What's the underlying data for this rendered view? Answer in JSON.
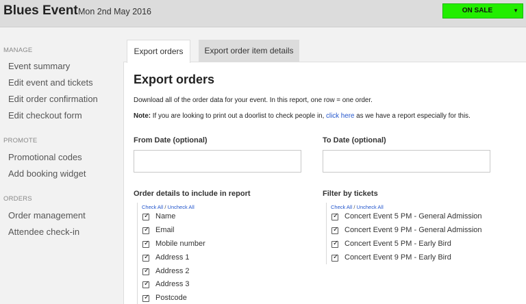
{
  "header": {
    "title": "Blues Event",
    "date": "Mon 2nd May 2016",
    "status": "ON SALE",
    "status_caret": "▼",
    "status_color": "#22ee00"
  },
  "sidebar": {
    "sections": [
      {
        "label": "MANAGE",
        "items": [
          "Event summary",
          "Edit event and tickets",
          "Edit order confirmation",
          "Edit checkout form"
        ]
      },
      {
        "label": "PROMOTE",
        "items": [
          "Promotional codes",
          "Add booking widget"
        ]
      },
      {
        "label": "ORDERS",
        "items": [
          "Order management",
          "Attendee check-in"
        ]
      }
    ]
  },
  "tabs": [
    {
      "label": "Export orders",
      "active": true
    },
    {
      "label": "Export order item details",
      "active": false
    }
  ],
  "main": {
    "heading": "Export orders",
    "intro": "Download all of the order data for your event. In this report, one row = one order.",
    "note_bold": "Note:",
    "note_pre": "If you are looking to print out a doorlist to check people in,",
    "note_link": "click here",
    "note_post": "as we have a report especially for this.",
    "from_date": {
      "label": "From Date (optional)",
      "value": "",
      "placeholder": ""
    },
    "to_date": {
      "label": "To Date (optional)",
      "value": "",
      "placeholder": ""
    },
    "order_details": {
      "label": "Order details to include in report",
      "check_all": "Check All",
      "separator": "/",
      "uncheck_all": "Uncheck All",
      "items": [
        {
          "label": "Name",
          "checked": true
        },
        {
          "label": "Email",
          "checked": true
        },
        {
          "label": "Mobile number",
          "checked": true
        },
        {
          "label": "Address 1",
          "checked": true
        },
        {
          "label": "Address 2",
          "checked": true
        },
        {
          "label": "Address 3",
          "checked": true
        },
        {
          "label": "Postcode",
          "checked": true
        }
      ]
    },
    "ticket_filter": {
      "label": "Filter by tickets",
      "check_all": "Check All",
      "separator": "/",
      "uncheck_all": "Uncheck All",
      "items": [
        {
          "label": "Concert Event 5 PM - General Admission",
          "checked": true
        },
        {
          "label": "Concert Event 9 PM - General Admission",
          "checked": true
        },
        {
          "label": "Concert Event 5 PM - Early Bird",
          "checked": true
        },
        {
          "label": "Concert Event 9 PM - Early Bird",
          "checked": true
        }
      ]
    }
  }
}
